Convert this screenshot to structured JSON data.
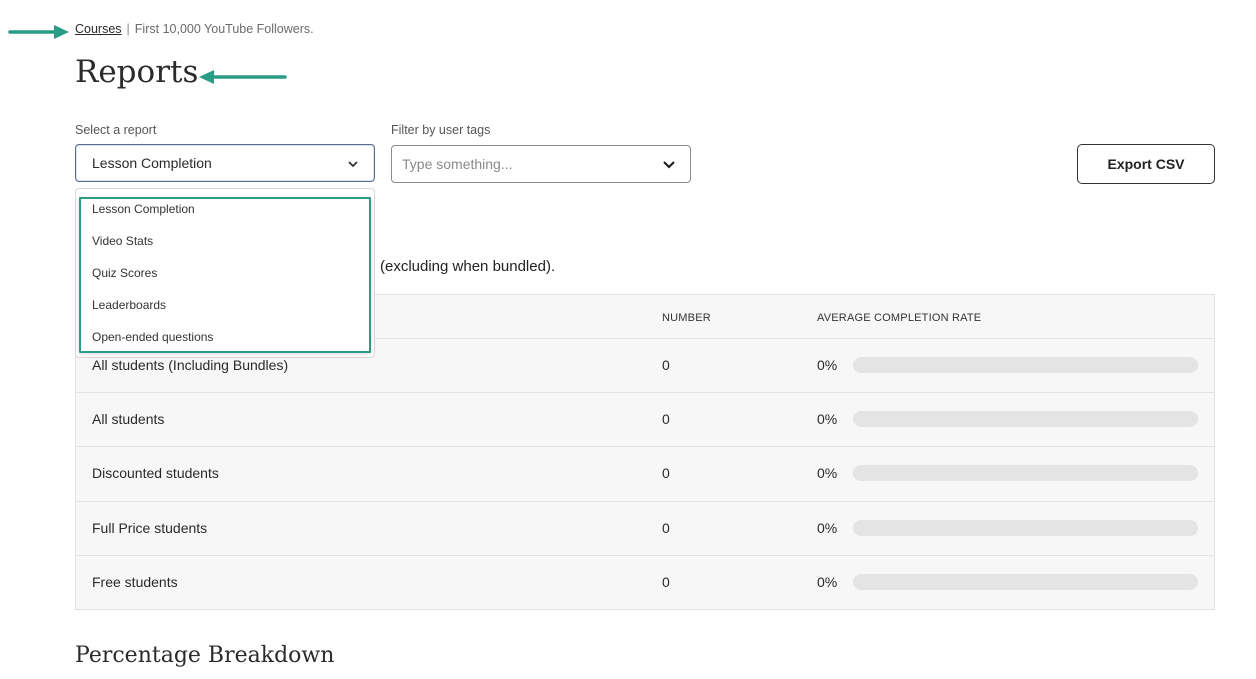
{
  "breadcrumb": {
    "link": "Courses",
    "separator": "|",
    "current": "First 10,000 YouTube Followers."
  },
  "page": {
    "title": "Reports"
  },
  "filters": {
    "report_label": "Select a report",
    "report_value": "Lesson Completion",
    "tags_label": "Filter by user tags",
    "tags_placeholder": "Type something..."
  },
  "actions": {
    "export_label": "Export CSV"
  },
  "report_menu": {
    "options": [
      "Lesson Completion",
      "Video Stats",
      "Quiz Scores",
      "Leaderboards",
      "Open-ended questions"
    ]
  },
  "description_partial": "(excluding when bundled).",
  "table": {
    "columns": [
      "NUMBER",
      "AVERAGE COMPLETION RATE"
    ],
    "rows": [
      {
        "name": "All students (Including Bundles)",
        "number": "0",
        "rate": "0%",
        "rate_fraction": 0
      },
      {
        "name": "All students",
        "number": "0",
        "rate": "0%",
        "rate_fraction": 0
      },
      {
        "name": "Discounted students",
        "number": "0",
        "rate": "0%",
        "rate_fraction": 0
      },
      {
        "name": "Full Price students",
        "number": "0",
        "rate": "0%",
        "rate_fraction": 0
      },
      {
        "name": "Free students",
        "number": "0",
        "rate": "0%",
        "rate_fraction": 0
      }
    ]
  },
  "sections": {
    "breakdown_title": "Percentage Breakdown"
  },
  "colors": {
    "annotation_arrow": "#2b9c86",
    "highlight_box": "#2b9c86",
    "bar_track": "#e4e4e4"
  },
  "icons": {
    "dropdown": "chevron-down-icon",
    "annotation": "arrow-right-icon"
  }
}
